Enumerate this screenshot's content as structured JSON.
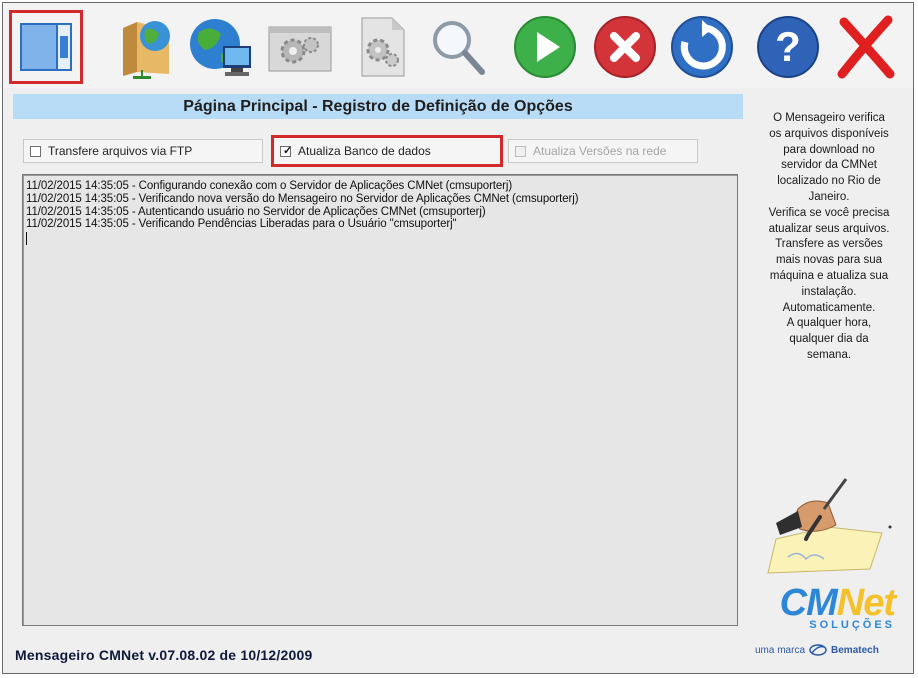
{
  "toolbar": {
    "buttons": [
      {
        "name": "main-page-button",
        "icon": "window-layout-icon"
      },
      {
        "name": "folder-network-button",
        "icon": "folder-globe-icon"
      },
      {
        "name": "internet-connection-button",
        "icon": "globe-computer-icon"
      },
      {
        "name": "settings-button",
        "icon": "gears-window-icon"
      },
      {
        "name": "settings-document-button",
        "icon": "gears-document-icon"
      },
      {
        "name": "search-button",
        "icon": "magnifier-icon"
      },
      {
        "name": "start-button",
        "icon": "play-icon"
      },
      {
        "name": "stop-button",
        "icon": "stop-x-icon"
      },
      {
        "name": "refresh-button",
        "icon": "refresh-icon"
      },
      {
        "name": "help-button",
        "icon": "help-icon"
      },
      {
        "name": "exit-button",
        "icon": "close-icon"
      }
    ]
  },
  "main": {
    "title": "Página Principal - Registro de Definição de Opções",
    "options": [
      {
        "label": "Transfere arquivos via FTP",
        "checked": false,
        "enabled": true
      },
      {
        "label": "Atualiza Banco de dados",
        "checked": true,
        "enabled": true
      },
      {
        "label": "Atualiza Versões na rede",
        "checked": false,
        "enabled": false
      }
    ],
    "log": [
      "11/02/2015 14:35:05 - Configurando conexão com o Servidor de Aplicações CMNet (cmsuporterj)",
      "11/02/2015 14:35:05 - Verificando nova versão do Mensageiro no Servidor de Aplicações CMNet (cmsuporterj)",
      "11/02/2015 14:35:05 - Autenticando usuário no Servidor de Aplicações CMNet (cmsuporterj)",
      "11/02/2015 14:35:05 - Verificando Pendências Liberadas para o Usuário \"cmsuporterj\""
    ]
  },
  "sidebar": {
    "info_lines": [
      "O Mensageiro verifica",
      "os arquivos disponíveis",
      "para download no",
      "servidor da CMNet",
      "localizado no Rio de",
      "Janeiro.",
      "Verifica se você precisa",
      "atualizar seus arquivos.",
      "Transfere as versões",
      "mais novas para sua",
      "máquina e atualiza sua",
      "instalação.",
      "Automaticamente.",
      "A qualquer hora,",
      "qualquer dia da",
      "semana."
    ],
    "logo_cm": "CM",
    "logo_net": "Net",
    "logo_subtitle": "SOLUÇÕES",
    "brand_prefix": "uma marca",
    "brand_name": "Bematech"
  },
  "footer": {
    "version_label": "Mensageiro CMNet v.07.08.02 de 10/12/2009"
  },
  "colors": {
    "highlight": "#d22a2a",
    "title_bar": "#b8dcf5",
    "logo_blue": "#2d86d6",
    "logo_yellow": "#f4c12a"
  }
}
